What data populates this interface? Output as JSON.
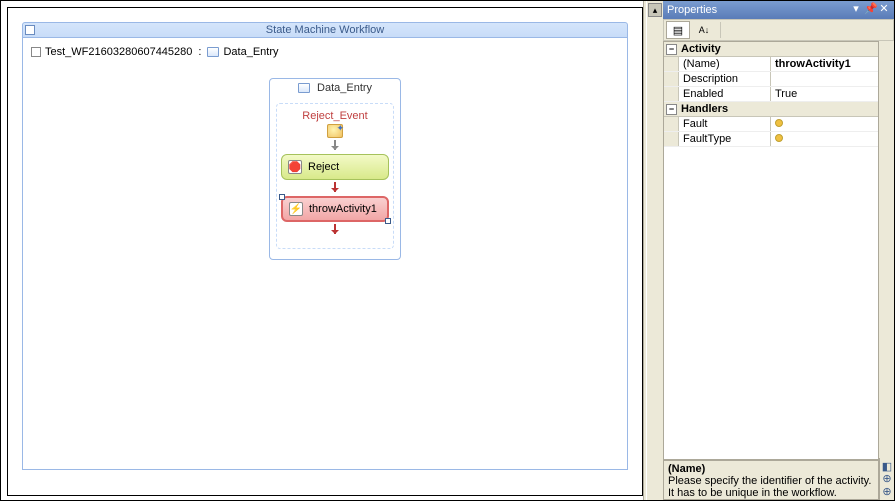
{
  "designer": {
    "title": "State Machine Workflow",
    "breadcrumb": {
      "root": "Test_WF21603280607445280",
      "sep": ":",
      "current": "Data_Entry"
    },
    "state": {
      "name": "Data_Entry",
      "event": {
        "name": "Reject_Event",
        "activities": [
          {
            "label": "Reject",
            "kind": "reject",
            "icon": "🛑"
          },
          {
            "label": "throwActivity1",
            "kind": "throw",
            "icon": "⚡"
          }
        ]
      }
    }
  },
  "properties": {
    "panel_title": "Properties",
    "categories": [
      {
        "name": "Activity",
        "rows": [
          {
            "name": "(Name)",
            "value": "throwActivity1",
            "selected": true
          },
          {
            "name": "Description",
            "value": ""
          },
          {
            "name": "Enabled",
            "value": "True"
          }
        ]
      },
      {
        "name": "Handlers",
        "rows": [
          {
            "name": "Fault",
            "value": "",
            "warn": true
          },
          {
            "name": "FaultType",
            "value": "",
            "warn": true
          }
        ]
      }
    ],
    "description": {
      "name": "(Name)",
      "text": "Please specify the identifier of the activity. It has to be unique in the workflow."
    }
  }
}
